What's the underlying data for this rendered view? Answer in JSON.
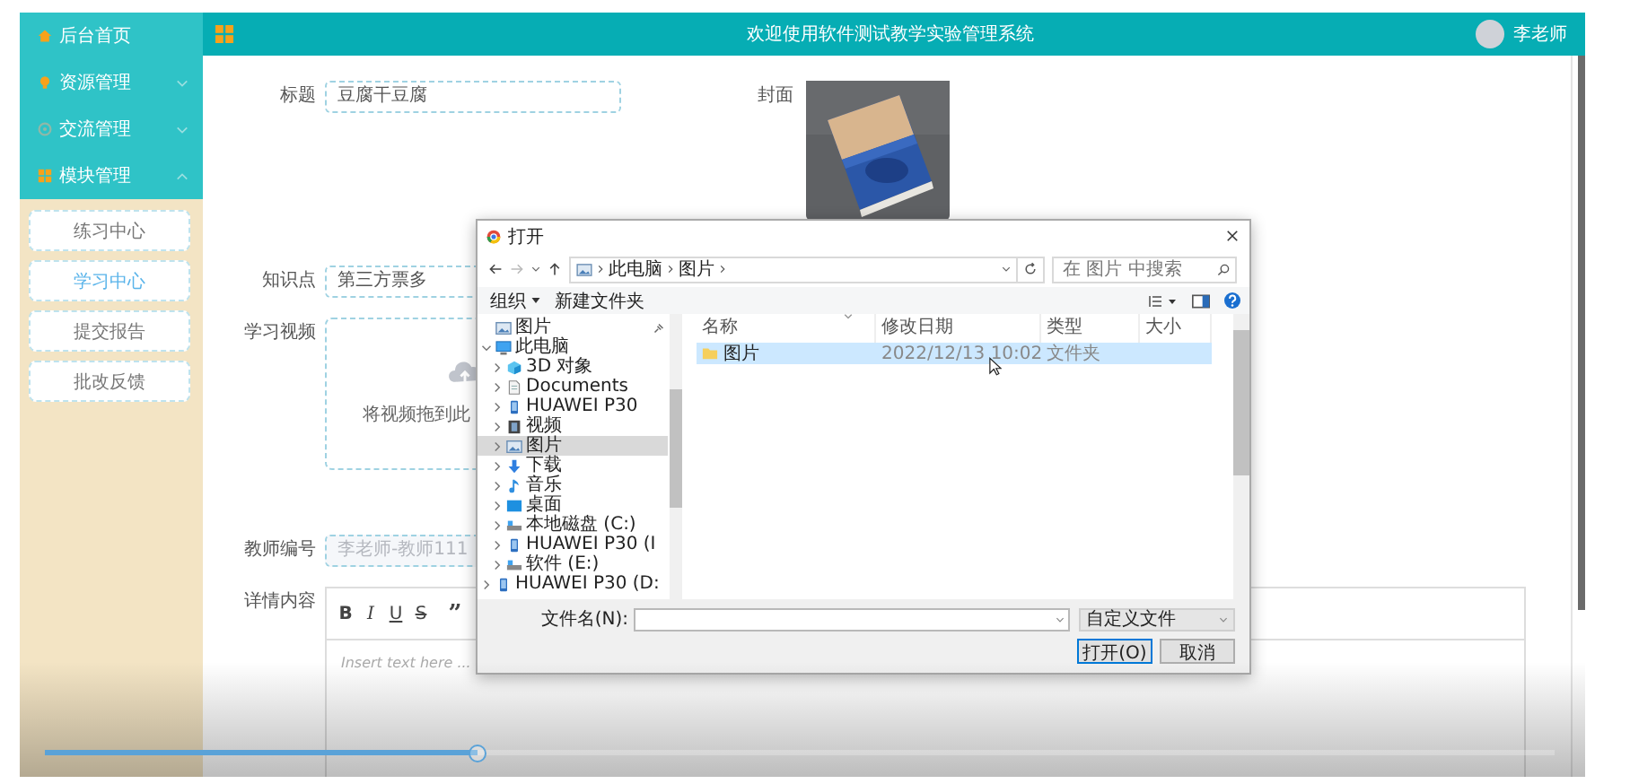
{
  "topbar": {
    "title": "欢迎使用软件测试教学实验管理系统",
    "user": "李老师"
  },
  "sidebar": {
    "items": [
      {
        "label": "后台首页",
        "kind": "home"
      },
      {
        "label": "资源管理",
        "kind": "bulb",
        "expanded": false
      },
      {
        "label": "交流管理",
        "kind": "chat",
        "expanded": false
      },
      {
        "label": "模块管理",
        "kind": "grid",
        "expanded": true,
        "children": [
          {
            "label": "练习中心",
            "selected": false
          },
          {
            "label": "学习中心",
            "selected": true
          },
          {
            "label": "提交报告",
            "selected": false
          },
          {
            "label": "批改反馈",
            "selected": false
          }
        ]
      }
    ]
  },
  "form": {
    "title_label": "标题",
    "title_value": "豆腐干豆腐",
    "cover_label": "封面",
    "topic_label": "知识点",
    "topic_value": "第三方票多",
    "video_label": "学习视频",
    "video_hint": "将视频拖到此",
    "teacher_label": "教师编号",
    "teacher_value": "李老师-教师111",
    "teacher_disabled": true,
    "detail_label": "详情内容",
    "editor_tools": [
      {
        "label": "B",
        "kind": "bold"
      },
      {
        "label": "I",
        "kind": "italic"
      },
      {
        "label": "U",
        "kind": "underline"
      },
      {
        "label": "S",
        "kind": "strike"
      },
      {
        "label": "”",
        "kind": "quote"
      }
    ],
    "editor_placeholder": "Insert text here ..."
  },
  "dialog": {
    "title": "打开",
    "path": [
      "此电脑",
      "图片"
    ],
    "search_placeholder": "在 图片 中搜索",
    "toolbar": [
      {
        "label": "组织",
        "menu": true
      },
      {
        "label": "新建文件夹",
        "menu": false
      }
    ],
    "tree": [
      {
        "label": "图片",
        "kind": "pictures",
        "selected": false
      },
      {
        "label": "此电脑",
        "kind": "computer",
        "expanded": true,
        "selected": false,
        "children": [
          {
            "label": "3D 对象",
            "kind": "cube",
            "expanded": false,
            "selected": false
          },
          {
            "label": "Documents",
            "kind": "document",
            "expanded": false,
            "selected": false
          },
          {
            "label": "HUAWEI P30",
            "kind": "phone",
            "expanded": false,
            "selected": false
          },
          {
            "label": "视频",
            "kind": "video",
            "expanded": false,
            "selected": false
          },
          {
            "label": "图片",
            "kind": "pictures",
            "expanded": false,
            "selected": true
          },
          {
            "label": "下载",
            "kind": "download",
            "expanded": false,
            "selected": false
          },
          {
            "label": "音乐",
            "kind": "music",
            "expanded": false,
            "selected": false
          },
          {
            "label": "桌面",
            "kind": "desktop",
            "expanded": false,
            "selected": false
          },
          {
            "label": "本地磁盘 (C:)",
            "kind": "drive",
            "expanded": false,
            "selected": false
          },
          {
            "label": "HUAWEI P30 (I",
            "kind": "phone",
            "expanded": false,
            "selected": false
          },
          {
            "label": "软件 (E:)",
            "kind": "drive",
            "expanded": false,
            "selected": false
          }
        ]
      },
      {
        "label": "HUAWEI P30 (D:",
        "kind": "phone",
        "expanded": false,
        "selected": false
      }
    ],
    "columns": [
      "名称",
      "修改日期",
      "类型",
      "大小"
    ],
    "rows": [
      {
        "name": "图片",
        "modified": "2022/12/13 10:02",
        "type": "文件夹",
        "selected": true
      }
    ],
    "filename_label": "文件名(N):",
    "filetype": "自定义文件",
    "buttons": [
      {
        "label": "打开(O)",
        "default": true
      },
      {
        "label": "取消",
        "default": false
      }
    ]
  },
  "player": {
    "level": 0.287
  }
}
